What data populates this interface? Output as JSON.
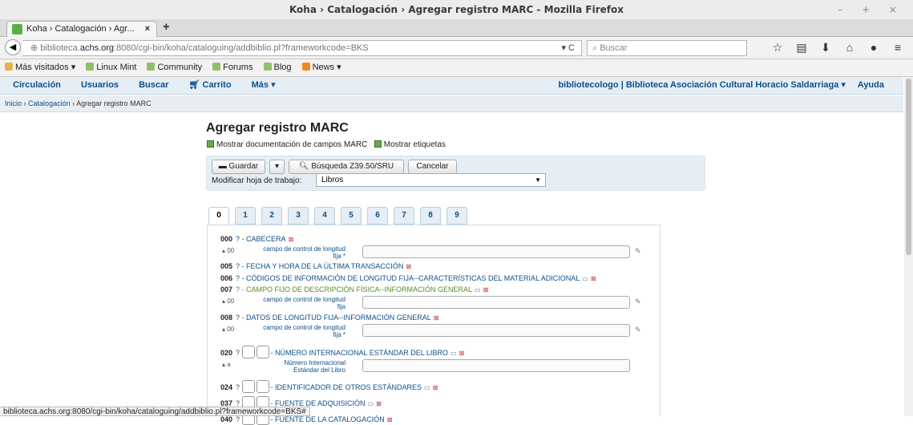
{
  "window": {
    "title": "Koha › Catalogación › Agregar registro MARC - Mozilla Firefox",
    "controls": "– + ×"
  },
  "browser": {
    "tab_title": "Koha › Catalogación › Agr...",
    "tab_close": "×",
    "new_tab": "+",
    "url_prefix": "biblioteca.",
    "url_domain": "achs.org",
    "url_rest": ":8080/cgi-bin/koha/cataloguing/addbiblio.pl?frameworkcode=BKS",
    "url_controls": "▾ C",
    "search_placeholder": "Buscar",
    "bookmarks": [
      {
        "label": "Más visitados ▾"
      },
      {
        "label": "Linux Mint"
      },
      {
        "label": "Community"
      },
      {
        "label": "Forums"
      },
      {
        "label": "Blog"
      },
      {
        "label": "News ▾"
      }
    ],
    "status_url": "biblioteca.achs.org:8080/cgi-bin/koha/cataloguing/addbiblio.pl?frameworkcode=BKS#"
  },
  "kohanav": {
    "items": [
      "Circulación",
      "Usuarios",
      "Buscar",
      "Carrito",
      "Más ▾"
    ],
    "user": "bibliotecologo",
    "sep": "|",
    "library": "Biblioteca Asociación Cultural Horacio Saldarriaga ▾",
    "help": "Ayuda"
  },
  "breadcrumb": {
    "home": "Inicio",
    "sep1": "›",
    "cat": "Catalogación",
    "sep2": "›",
    "current": "Agregar registro MARC"
  },
  "page": {
    "title": "Agregar registro MARC",
    "show_docs": "Mostrar documentación de campos MARC",
    "show_tags": "Mostrar etiquetas",
    "save": "Guardar",
    "z3950": "Búsqueda Z39.50/SRU",
    "cancel": "Cancelar",
    "sheet_label": "Modificar hoja de trabajo:",
    "sheet_value": "Libros",
    "tabs": [
      "0",
      "1",
      "2",
      "3",
      "4",
      "5",
      "6",
      "7",
      "8",
      "9"
    ]
  },
  "fields": [
    {
      "tag": "000",
      "label": "? - CABECERA"
    },
    {
      "tag": "005",
      "label": "? - FECHA Y HORA DE LA ÚLTIMA TRANSACCIÓN"
    },
    {
      "tag": "006",
      "label": "? - CÓDIGOS DE INFORMACIÓN DE LONGITUD FIJA--CARACTERÍSTICAS DEL MATERIAL ADICIONAL"
    },
    {
      "tag": "007",
      "label": "? - CAMPO FIJO DE DESCRIPCIÓN FÍSICA--INFORMACIÓN GENERAL"
    },
    {
      "tag": "008",
      "label": "? - DATOS DE LONGITUD FIJA--INFORMACIÓN GENERAL"
    },
    {
      "tag": "020",
      "label": "- NÚMERO INTERNACIONAL ESTÁNDAR DEL LIBRO"
    },
    {
      "tag": "024",
      "label": "- IDENTIFICADOR DE OTROS ESTÁNDARES"
    },
    {
      "tag": "037",
      "label": "- FUENTE DE ADQUISICIÓN"
    },
    {
      "tag": "040",
      "label": "- FUENTE DE LA CATALOGACIÓN"
    }
  ],
  "subfields": [
    {
      "code": "00",
      "label": "campo de control de longitud fija *"
    },
    {
      "code": "00",
      "label": "campo de control de longitud fija"
    },
    {
      "code": "00",
      "label": "campo de control de longitud fija *"
    },
    {
      "code": "a",
      "label": "Número Internacional Estándar del Libro"
    }
  ]
}
